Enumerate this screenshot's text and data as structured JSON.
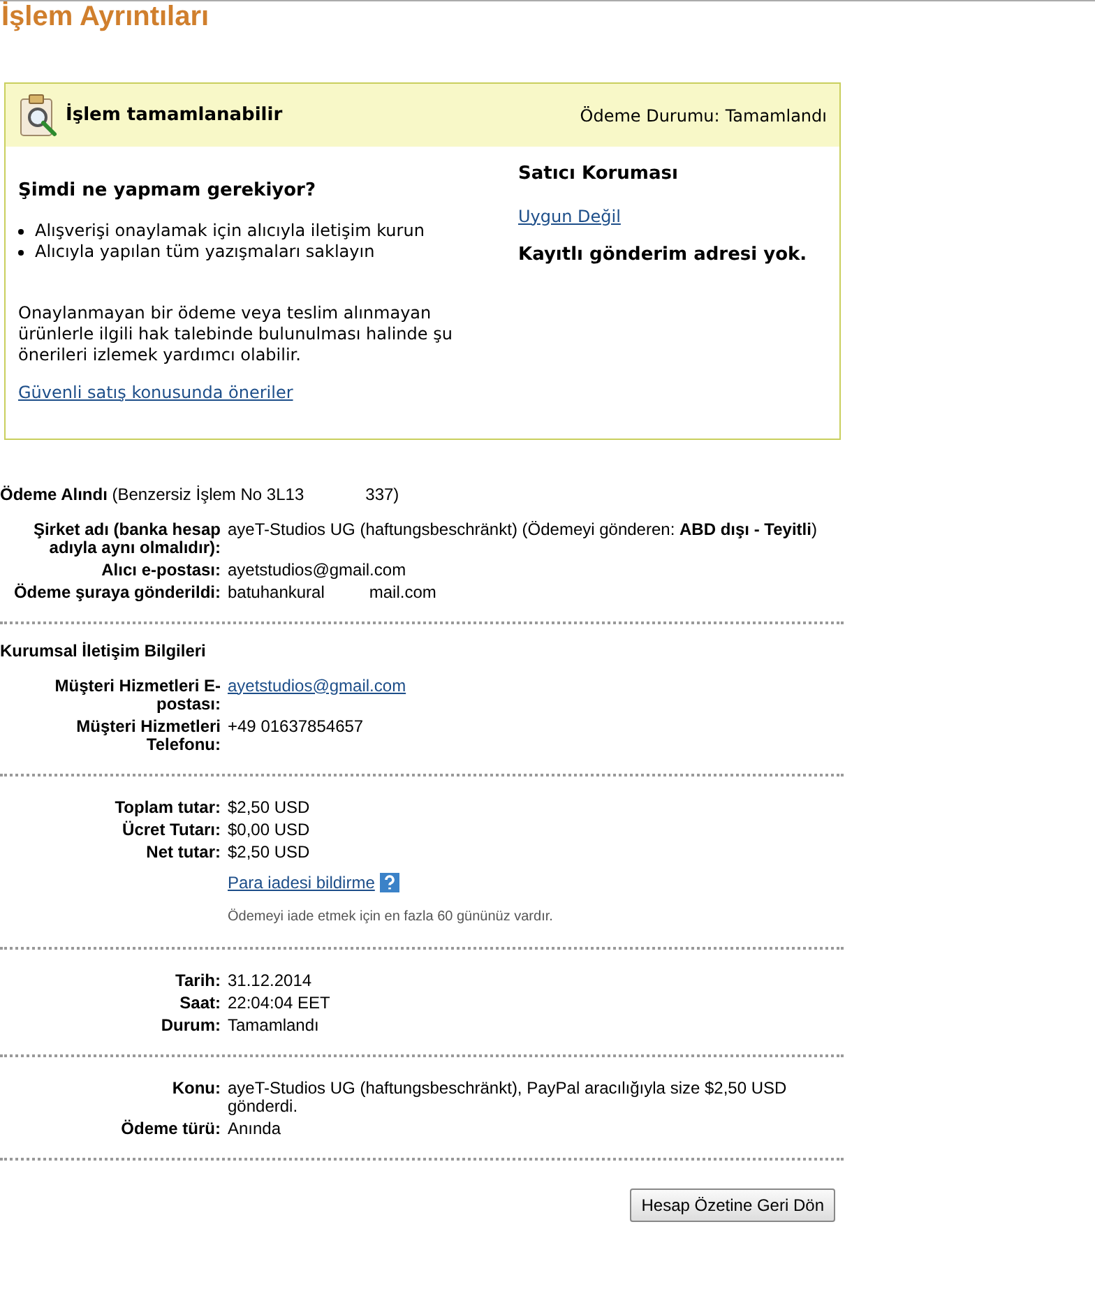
{
  "title": "İşlem Ayrıntıları",
  "status_box": {
    "heading": "İşlem tamamlanabilir",
    "status_label": "Ödeme Durumu:",
    "status_value": "Tamamlandı",
    "left": {
      "question": "Şimdi ne yapmam gerekiyor?",
      "bullets": [
        "Alışverişi onaylamak için alıcıyla iletişim kurun",
        "Alıcıyla yapılan tüm yazışmaları saklayın"
      ],
      "paragraph": "Onaylanmayan bir ödeme veya teslim alınmayan ürünlerle ilgili hak talebinde bulunulması halinde şu önerileri izlemek yardımcı olabilir.",
      "link": "Güvenli satış konusunda öneriler"
    },
    "right": {
      "heading": "Satıcı Koruması",
      "link": "Uygun Değil",
      "note": "Kayıtlı gönderim adresi yok."
    }
  },
  "sections": [
    {
      "heading_parts": [
        "**Ödeme Alındı** (Benzersiz İşlem No 3L13",
        "337)"
      ],
      "rows": [
        {
          "label": "Şirket adı (banka hesap adıyla aynı olmalıdır):",
          "kind": "text",
          "value": [
            "ayeT-Studios UG (haftungsbeschränkt) (Ödemeyi gönderen: **ABD dışı - Teyitli**)"
          ]
        },
        {
          "label": "Alıcı e-postası:",
          "kind": "text",
          "value": [
            "ayetstudios@gmail.com"
          ]
        },
        {
          "label": "Ödeme şuraya gönderildi:",
          "kind": "text",
          "value": [
            "batuhankural",
            "mail.com"
          ]
        }
      ]
    },
    {
      "heading_parts": [
        "Kurumsal İletişim Bilgileri"
      ],
      "rows": [
        {
          "label": "Müşteri Hizmetleri E-postası:",
          "kind": "link",
          "value": [
            "ayetstudios@gmail.com"
          ]
        },
        {
          "label": "Müşteri Hizmetleri Telefonu:",
          "kind": "text",
          "value": [
            "+49 01637854657"
          ]
        }
      ]
    },
    {
      "rows": [
        {
          "label": "Toplam tutar:",
          "kind": "text",
          "value": [
            "$2,50 USD"
          ]
        },
        {
          "label": "Ücret Tutarı:",
          "kind": "text",
          "value": [
            "$0,00 USD"
          ]
        },
        {
          "label": "Net tutar:",
          "kind": "text",
          "value": [
            "$2,50 USD"
          ]
        }
      ],
      "refund": {
        "link": "Para iadesi bildirme",
        "note": "Ödemeyi iade etmek için en fazla 60 gününüz vardır."
      }
    },
    {
      "rows": [
        {
          "label": "Tarih:",
          "kind": "text",
          "value": [
            "31.12.2014"
          ]
        },
        {
          "label": "Saat:",
          "kind": "text",
          "value": [
            "22:04:04 EET"
          ]
        },
        {
          "label": "Durum:",
          "kind": "text",
          "value": [
            "Tamamlandı"
          ]
        }
      ]
    },
    {
      "rows": [
        {
          "label": "Konu:",
          "kind": "text",
          "value": [
            "ayeT-Studios UG (haftungsbeschränkt), PayPal aracılığıyla size $2,50 USD gönderdi."
          ]
        },
        {
          "label": "Ödeme türü:",
          "kind": "text",
          "value": [
            "Anında"
          ]
        }
      ]
    }
  ],
  "back_button": "Hesap Özetine Geri Dön"
}
